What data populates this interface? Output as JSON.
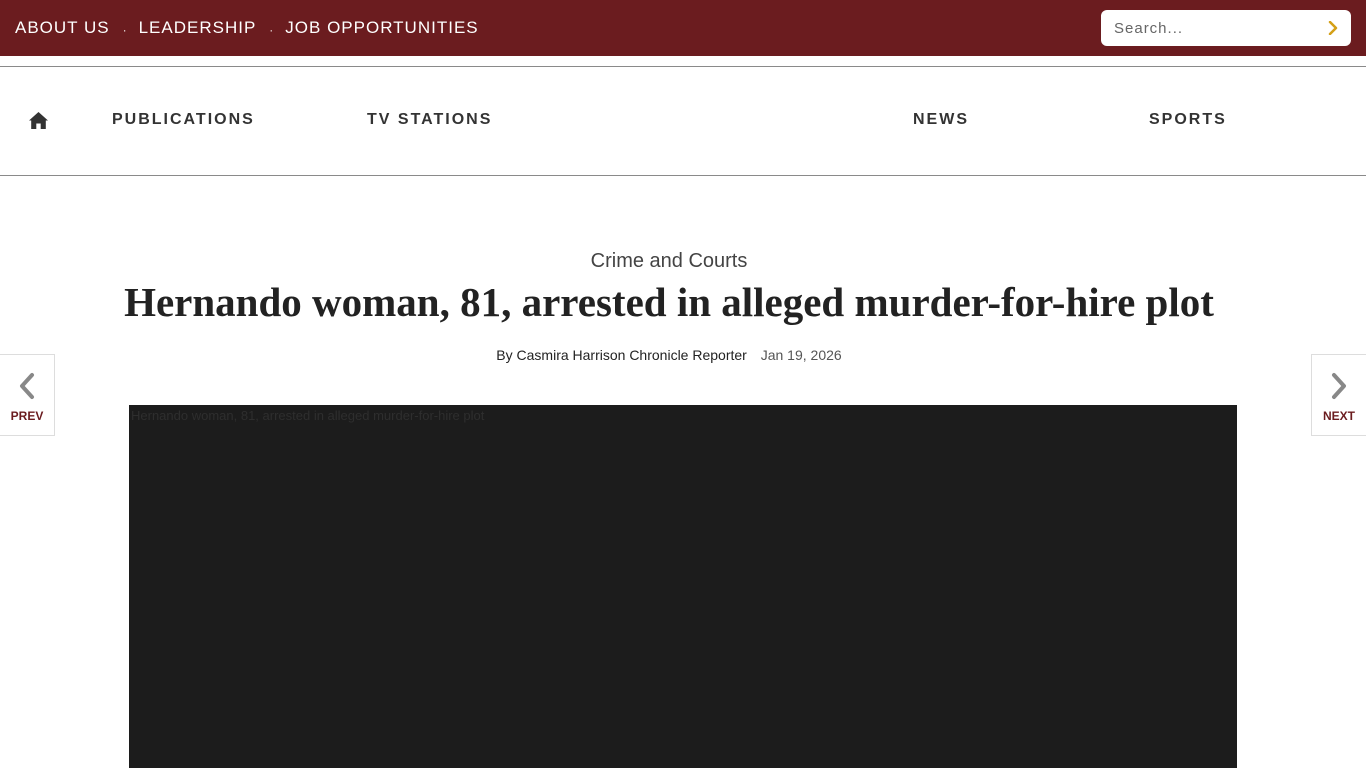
{
  "topbar": {
    "links": [
      {
        "label": "ABOUT US"
      },
      {
        "label": "LEADERSHIP"
      },
      {
        "label": "JOB OPPORTUNITIES"
      }
    ],
    "separator": "·",
    "search": {
      "placeholder": "Search...",
      "button_icon": "chevron-right-icon"
    },
    "colors": {
      "background": "#6b1c1f",
      "search_button": "#d4a017"
    }
  },
  "nav": {
    "home_icon": "home-icon",
    "items": [
      {
        "label": "PUBLICATIONS"
      },
      {
        "label": "TV STATIONS"
      },
      {
        "label": "NEWS"
      },
      {
        "label": "SPORTS"
      }
    ]
  },
  "article": {
    "section": "Crime and Courts",
    "headline": "Hernando woman, 81, arrested in alleged murder-for-hire plot",
    "byline": "By Casmira Harrison Chronicle Reporter",
    "date": "Jan 19, 2026",
    "image_alt": "Hernando woman, 81, arrested in alleged murder-for-hire plot"
  },
  "pager": {
    "prev_label": "PREV",
    "next_label": "NEXT",
    "prev_icon": "chevron-left-icon",
    "next_icon": "chevron-right-icon"
  }
}
